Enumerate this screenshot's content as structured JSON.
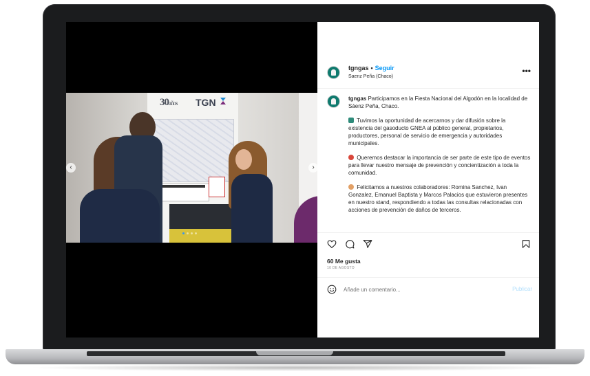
{
  "post": {
    "username": "tgngas",
    "separator": "•",
    "follow_label": "Seguir",
    "location": "Saenz Peña (Chaco)",
    "more_label": "•••",
    "caption_user": "tgngas",
    "caption_paragraphs": [
      "Participamos en la Fiesta Nacional del Algodón en la localidad de Sáenz Peña, Chaco.",
      "Tuvimos la oportunidad de acercarnos y dar difusión sobre la existencia del gasoducto GNEA al público general, propietarios, productores, personal de servicio de emergencia y autoridades municipales.",
      "Queremos destacar la importancia de ser parte de este tipo de eventos para llevar nuestro mensaje de prevención y concientización a toda la comunidad.",
      "Felicitamos a nuestros colaboradores: Romina Sanchez, Ivan Gonzalez, Emanuel Baptista y Marcos Palacios que estuvieron presentes en nuestro stand, respondiendo a todas las consultas relacionadas con acciones de prevención de daños de terceros."
    ],
    "caption_emoji_icons": [
      "map-icon",
      "target-icon",
      "face-icon"
    ],
    "likes": "60 Me gusta",
    "date": "10 DE AGOSTO",
    "comment_placeholder": "Añade un comentario...",
    "publish_label": "Publicar"
  },
  "photo": {
    "logo_30_number": "30",
    "logo_30_word": "años",
    "logo_tgn": "TGN",
    "carousel_dots": 4,
    "active_dot": 0
  },
  "icons": {
    "like": "heart-icon",
    "comment": "comment-icon",
    "share": "share-icon",
    "save": "bookmark-icon",
    "emoji": "emoji-icon",
    "prev": "chevron-left-icon",
    "next": "chevron-right-icon"
  },
  "colors": {
    "follow": "#0095f6",
    "publish_disabled": "#b2dffc",
    "avatar": "#0f7a6e",
    "active_dot": "#3897f0"
  }
}
